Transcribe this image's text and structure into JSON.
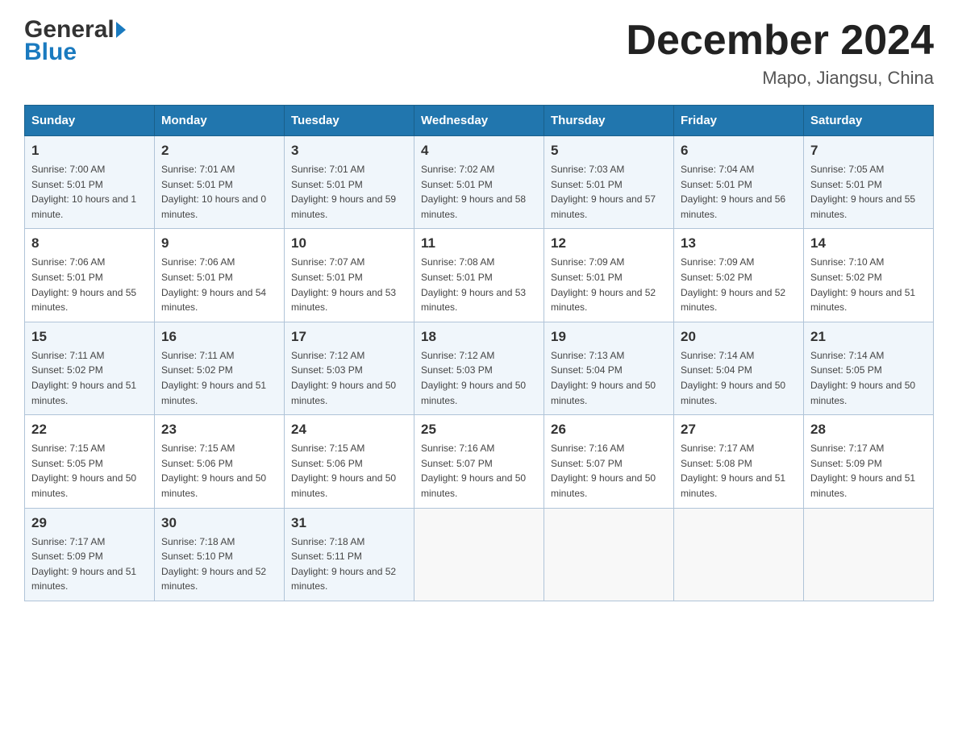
{
  "header": {
    "month_year": "December 2024",
    "location": "Mapo, Jiangsu, China",
    "logo_line1": "General",
    "logo_line2": "Blue"
  },
  "weekdays": [
    "Sunday",
    "Monday",
    "Tuesday",
    "Wednesday",
    "Thursday",
    "Friday",
    "Saturday"
  ],
  "weeks": [
    [
      {
        "day": "1",
        "sunrise": "7:00 AM",
        "sunset": "5:01 PM",
        "daylight": "10 hours and 1 minute."
      },
      {
        "day": "2",
        "sunrise": "7:01 AM",
        "sunset": "5:01 PM",
        "daylight": "10 hours and 0 minutes."
      },
      {
        "day": "3",
        "sunrise": "7:01 AM",
        "sunset": "5:01 PM",
        "daylight": "9 hours and 59 minutes."
      },
      {
        "day": "4",
        "sunrise": "7:02 AM",
        "sunset": "5:01 PM",
        "daylight": "9 hours and 58 minutes."
      },
      {
        "day": "5",
        "sunrise": "7:03 AM",
        "sunset": "5:01 PM",
        "daylight": "9 hours and 57 minutes."
      },
      {
        "day": "6",
        "sunrise": "7:04 AM",
        "sunset": "5:01 PM",
        "daylight": "9 hours and 56 minutes."
      },
      {
        "day": "7",
        "sunrise": "7:05 AM",
        "sunset": "5:01 PM",
        "daylight": "9 hours and 55 minutes."
      }
    ],
    [
      {
        "day": "8",
        "sunrise": "7:06 AM",
        "sunset": "5:01 PM",
        "daylight": "9 hours and 55 minutes."
      },
      {
        "day": "9",
        "sunrise": "7:06 AM",
        "sunset": "5:01 PM",
        "daylight": "9 hours and 54 minutes."
      },
      {
        "day": "10",
        "sunrise": "7:07 AM",
        "sunset": "5:01 PM",
        "daylight": "9 hours and 53 minutes."
      },
      {
        "day": "11",
        "sunrise": "7:08 AM",
        "sunset": "5:01 PM",
        "daylight": "9 hours and 53 minutes."
      },
      {
        "day": "12",
        "sunrise": "7:09 AM",
        "sunset": "5:01 PM",
        "daylight": "9 hours and 52 minutes."
      },
      {
        "day": "13",
        "sunrise": "7:09 AM",
        "sunset": "5:02 PM",
        "daylight": "9 hours and 52 minutes."
      },
      {
        "day": "14",
        "sunrise": "7:10 AM",
        "sunset": "5:02 PM",
        "daylight": "9 hours and 51 minutes."
      }
    ],
    [
      {
        "day": "15",
        "sunrise": "7:11 AM",
        "sunset": "5:02 PM",
        "daylight": "9 hours and 51 minutes."
      },
      {
        "day": "16",
        "sunrise": "7:11 AM",
        "sunset": "5:02 PM",
        "daylight": "9 hours and 51 minutes."
      },
      {
        "day": "17",
        "sunrise": "7:12 AM",
        "sunset": "5:03 PM",
        "daylight": "9 hours and 50 minutes."
      },
      {
        "day": "18",
        "sunrise": "7:12 AM",
        "sunset": "5:03 PM",
        "daylight": "9 hours and 50 minutes."
      },
      {
        "day": "19",
        "sunrise": "7:13 AM",
        "sunset": "5:04 PM",
        "daylight": "9 hours and 50 minutes."
      },
      {
        "day": "20",
        "sunrise": "7:14 AM",
        "sunset": "5:04 PM",
        "daylight": "9 hours and 50 minutes."
      },
      {
        "day": "21",
        "sunrise": "7:14 AM",
        "sunset": "5:05 PM",
        "daylight": "9 hours and 50 minutes."
      }
    ],
    [
      {
        "day": "22",
        "sunrise": "7:15 AM",
        "sunset": "5:05 PM",
        "daylight": "9 hours and 50 minutes."
      },
      {
        "day": "23",
        "sunrise": "7:15 AM",
        "sunset": "5:06 PM",
        "daylight": "9 hours and 50 minutes."
      },
      {
        "day": "24",
        "sunrise": "7:15 AM",
        "sunset": "5:06 PM",
        "daylight": "9 hours and 50 minutes."
      },
      {
        "day": "25",
        "sunrise": "7:16 AM",
        "sunset": "5:07 PM",
        "daylight": "9 hours and 50 minutes."
      },
      {
        "day": "26",
        "sunrise": "7:16 AM",
        "sunset": "5:07 PM",
        "daylight": "9 hours and 50 minutes."
      },
      {
        "day": "27",
        "sunrise": "7:17 AM",
        "sunset": "5:08 PM",
        "daylight": "9 hours and 51 minutes."
      },
      {
        "day": "28",
        "sunrise": "7:17 AM",
        "sunset": "5:09 PM",
        "daylight": "9 hours and 51 minutes."
      }
    ],
    [
      {
        "day": "29",
        "sunrise": "7:17 AM",
        "sunset": "5:09 PM",
        "daylight": "9 hours and 51 minutes."
      },
      {
        "day": "30",
        "sunrise": "7:18 AM",
        "sunset": "5:10 PM",
        "daylight": "9 hours and 52 minutes."
      },
      {
        "day": "31",
        "sunrise": "7:18 AM",
        "sunset": "5:11 PM",
        "daylight": "9 hours and 52 minutes."
      },
      null,
      null,
      null,
      null
    ]
  ]
}
